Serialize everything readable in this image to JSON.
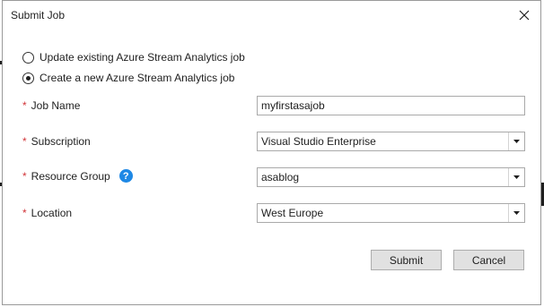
{
  "dialog": {
    "title": "Submit Job",
    "close_icon": "close-icon"
  },
  "options": [
    {
      "label": "Update existing Azure Stream Analytics job",
      "selected": false
    },
    {
      "label": "Create a new Azure Stream Analytics job",
      "selected": true
    }
  ],
  "fields": {
    "required_mark": "*",
    "job_name": {
      "label": "Job Name",
      "value": "myfirstasajob"
    },
    "subscription": {
      "label": "Subscription",
      "value": "Visual Studio Enterprise"
    },
    "resource_group": {
      "label": "Resource Group",
      "value": "asablog",
      "help_icon": "help-icon",
      "help_glyph": "?"
    },
    "location": {
      "label": "Location",
      "value": "West Europe"
    }
  },
  "buttons": {
    "submit": "Submit",
    "cancel": "Cancel"
  },
  "colors": {
    "required": "#d13438",
    "help": "#1e88e5"
  }
}
